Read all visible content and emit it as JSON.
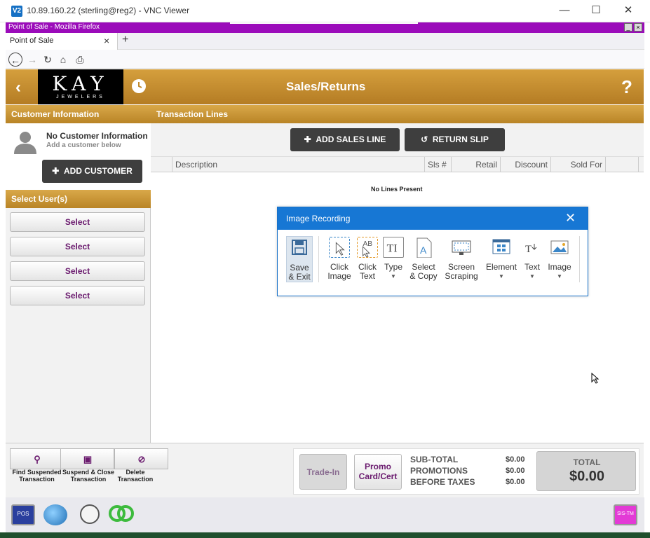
{
  "vnc": {
    "title": "10.89.160.22 (sterling@reg2) - VNC Viewer",
    "icon_label": "V2"
  },
  "firefox": {
    "title": "Point of Sale - Mozilla Firefox",
    "tab_label": "Point of Sale"
  },
  "header": {
    "title": "Sales/Returns",
    "logo_main": "KAY",
    "logo_sub": "JEWELERS",
    "help_label": "?"
  },
  "left": {
    "customer_header": "Customer Information",
    "no_customer": "No Customer Information",
    "add_below": "Add a customer below",
    "add_customer_label": "ADD CUSTOMER",
    "users_header": "Select User(s)",
    "select_buttons": [
      "Select",
      "Select",
      "Select",
      "Select"
    ]
  },
  "transaction": {
    "header": "Transaction Lines",
    "add_sales_line": "ADD SALES LINE",
    "return_slip": "RETURN SLIP",
    "columns": [
      "Description",
      "Sls #",
      "Retail",
      "Discount",
      "Sold For"
    ],
    "empty_message": "No Lines Present"
  },
  "footer": {
    "find_suspended": "Find Suspended Transaction",
    "suspend_close": "Suspend & Close Transaction",
    "delete_transaction": "Delete Transaction",
    "trade_in": "Trade-In",
    "promo": "Promo Card/Cert",
    "subtotal_label": "SUB-TOTAL",
    "subtotal_value": "$0.00",
    "promotions_label": "PROMOTIONS",
    "promotions_value": "$0.00",
    "before_taxes_label": "BEFORE TAXES",
    "before_taxes_value": "$0.00",
    "total_label": "TOTAL",
    "total_value": "$0.00"
  },
  "dialog": {
    "title": "Image Recording",
    "tools": [
      {
        "label": "Save & Exit"
      },
      {
        "label": "Click Image"
      },
      {
        "label": "Click Text"
      },
      {
        "label": "Type"
      },
      {
        "label": "Select & Copy"
      },
      {
        "label": "Screen Scraping"
      },
      {
        "label": "Element"
      },
      {
        "label": "Text"
      },
      {
        "label": "Image"
      }
    ]
  },
  "taskbar": {
    "pos_label": "POS",
    "sis_label": "SIS-TM"
  },
  "colors": {
    "gold": "#c8922f",
    "purple_text": "#6a1a6e",
    "firefox_purple": "#9b0bba",
    "dialog_blue": "#1777d4"
  }
}
